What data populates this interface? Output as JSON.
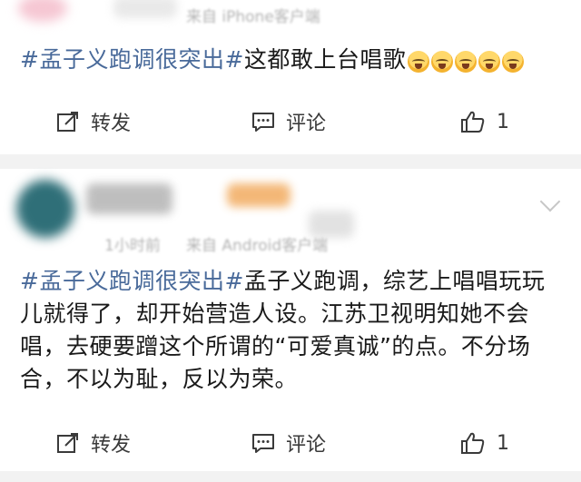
{
  "posts": [
    {
      "meta_source": "来自 iPhone客户端",
      "topic": "#孟子义跑调很突出#",
      "text": "这都敢上台唱歌",
      "emoji": [
        "scream-emoji",
        "scream-emoji",
        "scream-emoji",
        "scream-emoji",
        "scream-emoji"
      ],
      "actions": {
        "repost": "转发",
        "comment": "评论",
        "like_count": "1"
      }
    },
    {
      "meta_time": "1小时前",
      "meta_source": "来自 Android客户端",
      "topic": "#孟子义跑调很突出#",
      "text_lines": [
        "孟子义跑调，综艺上唱唱玩玩",
        "儿就得了，却开始营造人设。江苏卫视明知她不会",
        "唱，去硬要蹭这个所谓的“可爱真诚”的点。不分场",
        "合，不以为耻，反以为荣。"
      ],
      "actions": {
        "repost": "转发",
        "comment": "评论",
        "like_count": "1"
      }
    }
  ],
  "colors": {
    "topic": "#496a9a",
    "separator": "#f2f2f2",
    "meta": "#b3b3b3"
  }
}
